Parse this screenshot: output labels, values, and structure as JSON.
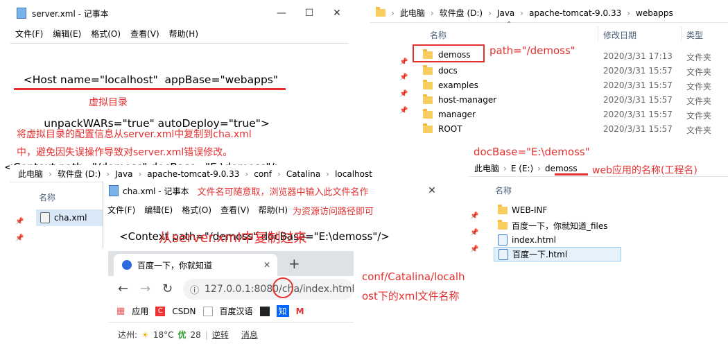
{
  "server_notepad": {
    "title": "server.xml - 记事本",
    "menu": [
      "文件(F)",
      "编辑(E)",
      "格式(O)",
      "查看(V)",
      "帮助(H)"
    ],
    "lines": [
      "    <Host name=\"localhost\"  appBase=\"webapps\"",
      "          unpackWARs=\"true\" autoDeploy=\"true\">",
      "<Context path=\"/demoss\" docBase=\"E:\\demoss\"/>"
    ]
  },
  "annotations": {
    "virtual_dir": "虚拟目录",
    "copy_note_1": "将虚拟目录的配置信息从server.xml中复制到cha.xml",
    "copy_note_2": "中，避免因失误操作导致对server.xml错误修改。",
    "path_label": "path=\"/demoss\"",
    "docbase_label": "docBase=\"E:\\demoss\"",
    "webapp_label": "web应用的名称(工程名)",
    "filename_note": "文件名可随意取，浏览器中输入此文件名作",
    "filename_note_2": "为资源访问路径即可",
    "copied_from": "从server.xml中复制过来",
    "conf_note_1": "conf/Catalina/localh",
    "conf_note_2": "ost下的xml文件名称"
  },
  "webapps_explorer": {
    "breadcrumb": [
      "此电脑",
      "软件盘 (D:)",
      "Java",
      "apache-tomcat-9.0.33",
      "webapps"
    ],
    "columns": {
      "name": "名称",
      "date": "修改日期",
      "type": "类型"
    },
    "rows": [
      {
        "name": "demoss",
        "date": "2020/3/31 17:13",
        "type": "文件夹"
      },
      {
        "name": "docs",
        "date": "2020/3/31 15:57",
        "type": "文件夹"
      },
      {
        "name": "examples",
        "date": "2020/3/31 15:57",
        "type": "文件夹"
      },
      {
        "name": "host-manager",
        "date": "2020/3/31 15:57",
        "type": "文件夹"
      },
      {
        "name": "manager",
        "date": "2020/3/31 15:57",
        "type": "文件夹"
      },
      {
        "name": "ROOT",
        "date": "2020/3/31 15:57",
        "type": "文件夹"
      }
    ]
  },
  "catalina_explorer": {
    "breadcrumb": [
      "此电脑",
      "软件盘 (D:)",
      "Java",
      "apache-tomcat-9.0.33",
      "conf",
      "Catalina",
      "localhost"
    ],
    "column_name": "名称",
    "file": "cha.xml"
  },
  "cha_notepad": {
    "title": "cha.xml - 记事本",
    "menu": [
      "文件(F)",
      "编辑(E)",
      "格式(O)",
      "查看(V)",
      "帮助(H)"
    ],
    "line": "<Context path=\"/demoss\" docBase=\"E:\\demoss\"/>"
  },
  "demoss_explorer": {
    "breadcrumb": [
      "此电脑",
      "E (E:)",
      "demoss"
    ],
    "column_name": "名称",
    "rows": [
      {
        "name": "WEB-INF",
        "icon": "folder-icon"
      },
      {
        "name": "百度一下，你就知道_files",
        "icon": "folder-icon"
      },
      {
        "name": "index.html",
        "icon": "ie-file-icon"
      },
      {
        "name": "百度一下.html",
        "icon": "ie-file-icon"
      }
    ]
  },
  "browser": {
    "tab_title": "百度一下，你就知道",
    "url_host": "127.0.0.1:8080/",
    "url_path_highlight": "cha",
    "url_rest": "/index.html",
    "bookmarks": [
      "应用",
      "CSDN",
      "百度汉语",
      "知",
      "M"
    ],
    "status": {
      "city": "达州:",
      "temp": "18°C",
      "aqi_label": "优",
      "aqi": "28",
      "link1": "逆转",
      "link2": "消息"
    }
  },
  "colors": {
    "accent_red": "#e53030",
    "folder": "#f6cd5e"
  }
}
